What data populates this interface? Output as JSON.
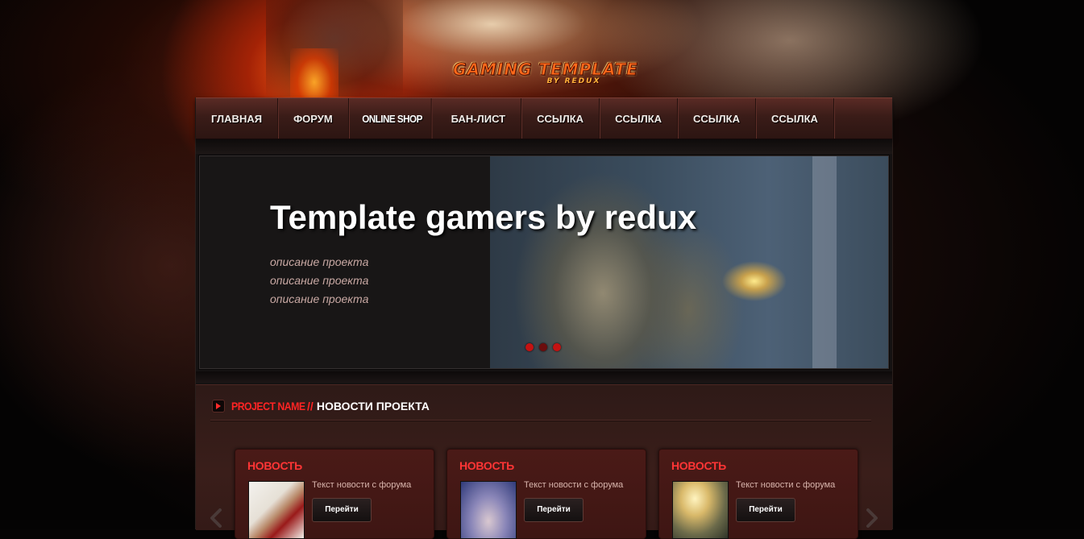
{
  "logo": {
    "main": "GAMING TEMPLATE",
    "sub": "BY REDUX"
  },
  "nav": {
    "items": [
      {
        "label": "ГЛАВНАЯ"
      },
      {
        "label": "ФОРУМ"
      },
      {
        "label": "ONLINE SHOP"
      },
      {
        "label": "БАН-ЛИСТ"
      },
      {
        "label": "ССЫЛКА"
      },
      {
        "label": "ССЫЛКА"
      },
      {
        "label": "ССЫЛКА"
      },
      {
        "label": "ССЫЛКА"
      }
    ]
  },
  "slider": {
    "title": "Template gamers by redux",
    "descriptions": [
      "описание проекта",
      "описание проекта",
      "описание проекта"
    ],
    "slide_count": 3,
    "active_slide": 2
  },
  "news": {
    "project": "PROJECT NAME",
    "separator": "//",
    "title": "НОВОСТИ ПРОЕКТА",
    "cards": [
      {
        "label": "НОВОСТЬ",
        "text": "Текст новости с форума",
        "button": "Перейти"
      },
      {
        "label": "НОВОСТЬ",
        "text": "Текст новости с форума",
        "button": "Перейти"
      },
      {
        "label": "НОВОСТЬ",
        "text": "Текст новости с форума",
        "button": "Перейти"
      }
    ]
  },
  "colors": {
    "accent": "#ff2424",
    "nav_text": "#f2ece8",
    "background": "#050404"
  },
  "icons": {
    "news_header": "chevron-right-icon",
    "prev": "chevron-left-icon",
    "next": "chevron-right-icon"
  }
}
